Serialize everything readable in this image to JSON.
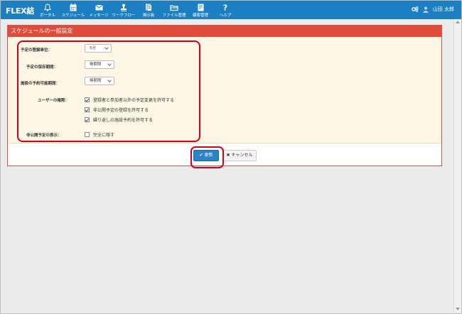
{
  "app": {
    "logo": "FLEX結"
  },
  "nav": [
    {
      "label": "ポータル",
      "icon": "bell-icon"
    },
    {
      "label": "スケジュール",
      "icon": "calendar-icon"
    },
    {
      "label": "メッセージ",
      "icon": "mail-icon"
    },
    {
      "label": "ワークフロー",
      "icon": "stamp-icon"
    },
    {
      "label": "掲示板",
      "icon": "board-icon"
    },
    {
      "label": "ファイル管理",
      "icon": "folder-icon"
    },
    {
      "label": "顧客管理",
      "icon": "customer-icon"
    },
    {
      "label": "ヘルプ",
      "icon": "help-icon"
    }
  ],
  "user": {
    "name": "山田 太郎"
  },
  "panel": {
    "title": "スケジュールの一般設定",
    "fields": {
      "unit": {
        "label": "予定の登録単位：",
        "value": "5分"
      },
      "retention": {
        "label": "予定の保存期間：",
        "value": "無期限"
      },
      "facility": {
        "label": "施設の予約可能期間：",
        "value": "無期限"
      },
      "permissions": {
        "label": "ユーザーの権限：",
        "options": [
          {
            "label": "登録者と参加者以外の予定変更を許可する",
            "checked": true
          },
          {
            "label": "非公開予定の登録を許可する",
            "checked": true
          },
          {
            "label": "繰り返しの施設予約を許可する",
            "checked": true
          }
        ]
      },
      "private_display": {
        "label": "非公開予定の表示：",
        "option": "完全に隠す",
        "checked": false
      }
    }
  },
  "buttons": {
    "update": "✔ 更新",
    "cancel": "✖ キャンセル"
  },
  "colors": {
    "topbar": "#1c7fc2",
    "panel_header": "#e04c3c",
    "highlight": "#d4001a",
    "primary_button": "#2b82c4"
  }
}
